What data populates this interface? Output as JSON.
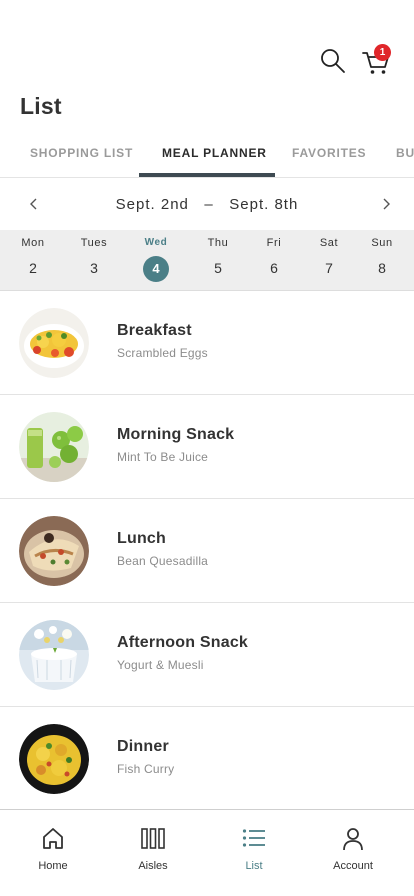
{
  "header": {
    "title": "List",
    "cart_count": "1",
    "icons": {
      "search": "search-icon",
      "cart": "cart-icon"
    }
  },
  "tabs": [
    {
      "label": "SHOPPING LIST",
      "active": false
    },
    {
      "label": "MEAL PLANNER",
      "active": true
    },
    {
      "label": "FAVORITES",
      "active": false
    },
    {
      "label": "BUY",
      "active": false
    }
  ],
  "week": {
    "range_start": "Sept. 2nd",
    "separator": "–",
    "range_end": "Sept. 8th"
  },
  "days": [
    {
      "name": "Mon",
      "num": "2",
      "selected": false
    },
    {
      "name": "Tues",
      "num": "3",
      "selected": false
    },
    {
      "name": "Wed",
      "num": "4",
      "selected": true
    },
    {
      "name": "Thu",
      "num": "5",
      "selected": false
    },
    {
      "name": "Fri",
      "num": "6",
      "selected": false
    },
    {
      "name": "Sat",
      "num": "7",
      "selected": false
    },
    {
      "name": "Sun",
      "num": "8",
      "selected": false
    }
  ],
  "meals": [
    {
      "title": "Breakfast",
      "subtitle": "Scrambled Eggs",
      "image": "scrambled-eggs-photo"
    },
    {
      "title": "Morning Snack",
      "subtitle": "Mint To Be Juice",
      "image": "green-juice-photo"
    },
    {
      "title": "Lunch",
      "subtitle": "Bean Quesadilla",
      "image": "quesadilla-photo"
    },
    {
      "title": "Afternoon Snack",
      "subtitle": "Yogurt & Muesli",
      "image": "yogurt-photo"
    },
    {
      "title": "Dinner",
      "subtitle": "Fish Curry",
      "image": "fish-curry-photo"
    }
  ],
  "bottom_nav": [
    {
      "label": "Home",
      "icon": "home-icon",
      "active": false
    },
    {
      "label": "Aisles",
      "icon": "aisles-icon",
      "active": false
    },
    {
      "label": "List",
      "icon": "list-icon",
      "active": true
    },
    {
      "label": "Account",
      "icon": "account-icon",
      "active": false
    }
  ],
  "colors": {
    "accent": "#4b7f87",
    "badge": "#e0262a",
    "tab_indicator": "#3e4a52",
    "day_strip": "#eeeeee"
  }
}
